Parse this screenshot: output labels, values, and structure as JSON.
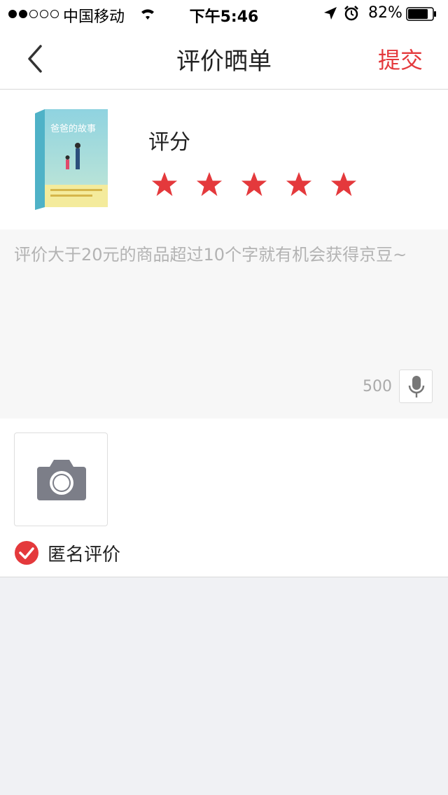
{
  "status_bar": {
    "carrier": "中国移动",
    "time": "下午5:46",
    "battery": "82%",
    "signal_bars_filled": 2,
    "signal_bars_total": 5
  },
  "nav": {
    "title": "评价晒单",
    "submit_label": "提交"
  },
  "product": {
    "rating_label": "评分",
    "rating_value": 5,
    "rating_max": 5,
    "book_title": "爸爸的故事"
  },
  "review": {
    "placeholder": "评价大于20元的商品超过10个字就有机会获得京豆~",
    "char_limit": "500"
  },
  "anonymous": {
    "label": "匿名评价",
    "checked": true
  },
  "colors": {
    "accent": "#e4393c",
    "star": "#e4393c",
    "placeholder": "#b3b3b3",
    "background": "#f0f1f4"
  },
  "icons": [
    "back-chevron-icon",
    "wifi-icon",
    "location-arrow-icon",
    "alarm-icon",
    "battery-icon",
    "star-icon",
    "microphone-icon",
    "camera-icon",
    "check-circle-icon"
  ]
}
